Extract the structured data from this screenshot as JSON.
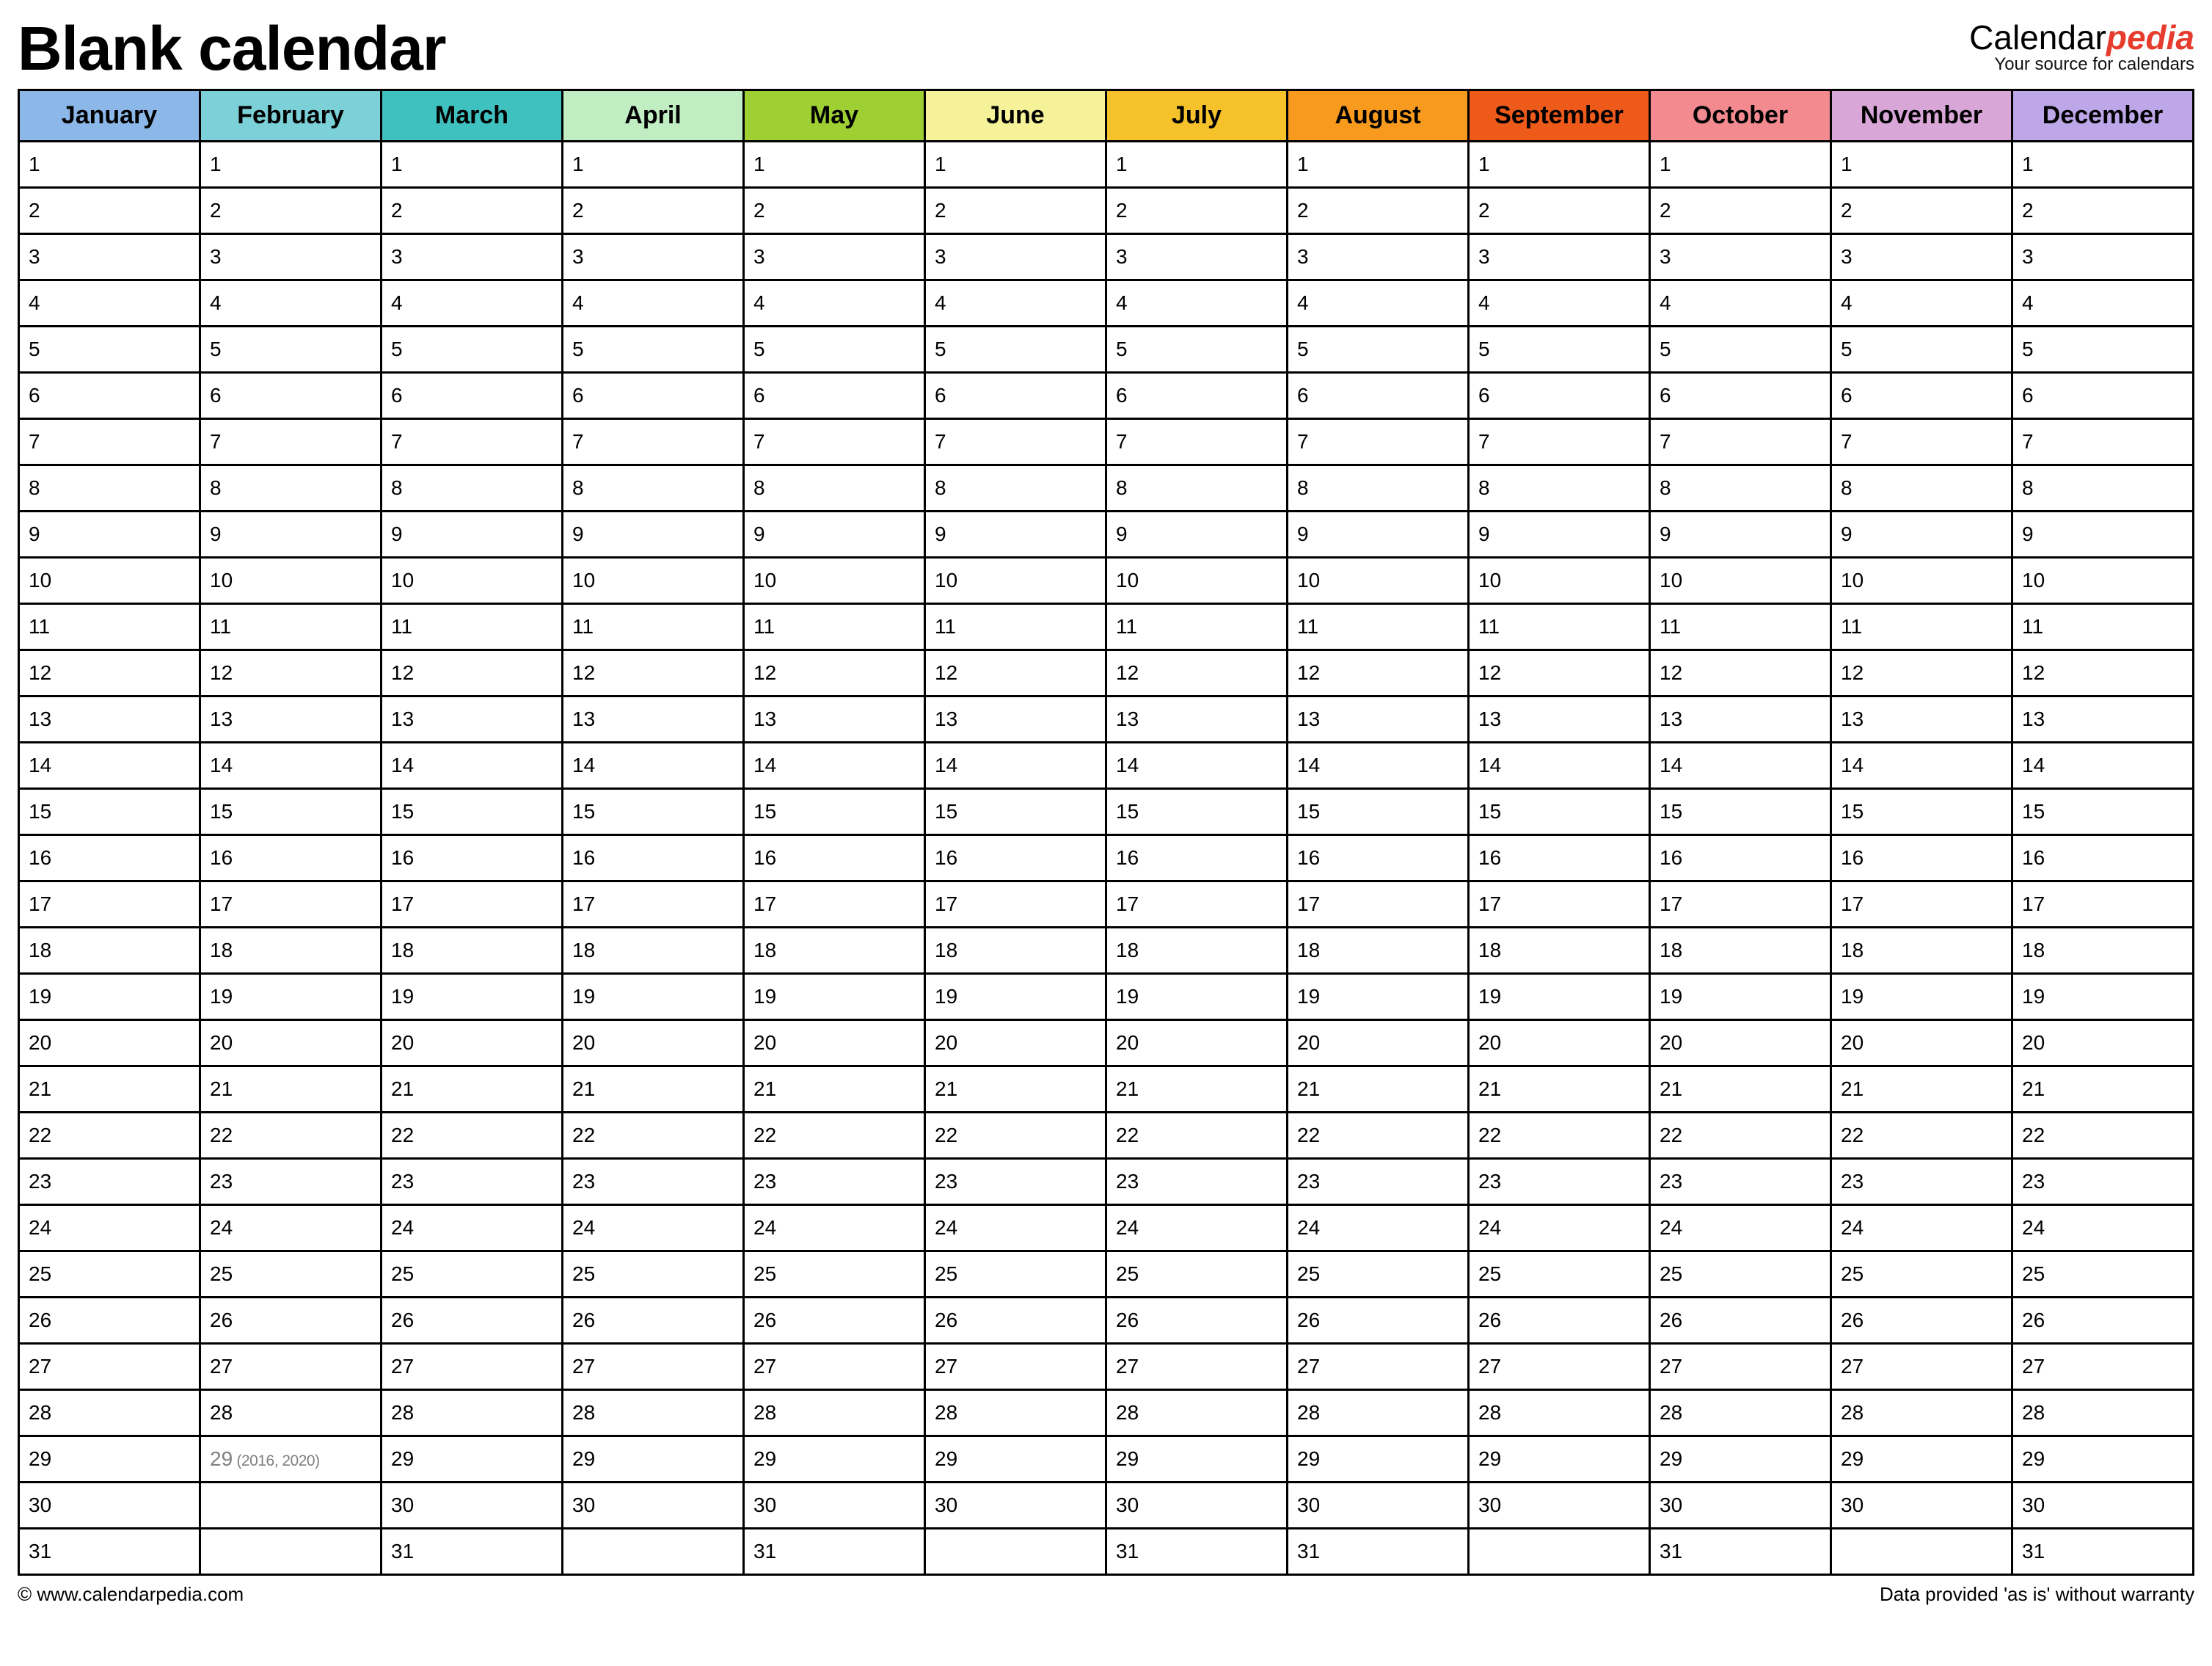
{
  "title": "Blank calendar",
  "brand": {
    "prefix": "Calendar",
    "suffix": "pedia",
    "tagline": "Your source for calendars"
  },
  "months": [
    {
      "name": "January",
      "color": "#8bb8e8",
      "days": 31
    },
    {
      "name": "February",
      "color": "#7cd0d8",
      "days": 28,
      "leap": {
        "day": "29",
        "note": "(2016, 2020)"
      }
    },
    {
      "name": "March",
      "color": "#3fc1bf",
      "days": 31
    },
    {
      "name": "April",
      "color": "#c1edc3",
      "days": 30
    },
    {
      "name": "May",
      "color": "#9ed033",
      "days": 31
    },
    {
      "name": "June",
      "color": "#f5f29a",
      "days": 30
    },
    {
      "name": "July",
      "color": "#f6c22b",
      "days": 31
    },
    {
      "name": "August",
      "color": "#f79a1e",
      "days": 31
    },
    {
      "name": "September",
      "color": "#ed5a1a",
      "days": 30
    },
    {
      "name": "October",
      "color": "#f28a8f",
      "days": 31
    },
    {
      "name": "November",
      "color": "#d8a7d8",
      "days": 30
    },
    {
      "name": "December",
      "color": "#bda7e8",
      "days": 31
    }
  ],
  "max_rows": 31,
  "footer": {
    "copyright": "© www.calendarpedia.com",
    "disclaimer": "Data provided 'as is' without warranty"
  }
}
